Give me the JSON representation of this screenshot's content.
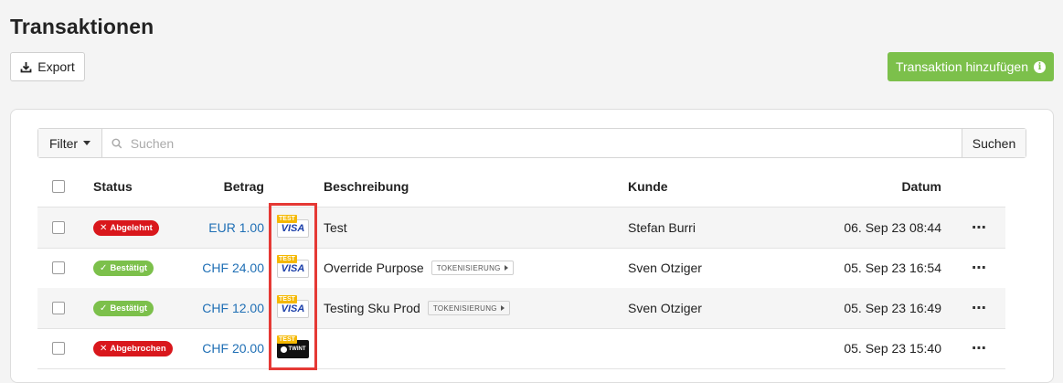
{
  "page": {
    "title": "Transaktionen"
  },
  "toolbar": {
    "export_label": "Export",
    "add_label": "Transaktion hinzufügen"
  },
  "search": {
    "filter_label": "Filter",
    "placeholder": "Suchen",
    "button_label": "Suchen"
  },
  "table": {
    "headers": {
      "status": "Status",
      "amount": "Betrag",
      "description": "Beschreibung",
      "customer": "Kunde",
      "date": "Datum"
    },
    "rows": [
      {
        "status": "Abgelehnt",
        "status_type": "declined",
        "amount": "EUR 1.00",
        "payment_method": "visa-test",
        "description": "Test",
        "tag": "",
        "customer": "Stefan Burri",
        "date": "06. Sep 23 08:44"
      },
      {
        "status": "Bestätigt",
        "status_type": "confirmed",
        "amount": "CHF 24.00",
        "payment_method": "visa-test",
        "description": "Override Purpose",
        "tag": "TOKENISIERUNG",
        "customer": "Sven Otziger",
        "date": "05. Sep 23 16:54"
      },
      {
        "status": "Bestätigt",
        "status_type": "confirmed",
        "amount": "CHF 12.00",
        "payment_method": "visa-test",
        "description": "Testing Sku Prod",
        "tag": "TOKENISIERUNG",
        "customer": "Sven Otziger",
        "date": "05. Sep 23 16:49"
      },
      {
        "status": "Abgebrochen",
        "status_type": "cancelled",
        "amount": "CHF 20.00",
        "payment_method": "twint-test",
        "description": "",
        "tag": "",
        "customer": "",
        "date": "05. Sep 23 15:40"
      }
    ]
  },
  "payment_labels": {
    "visa": "VISA",
    "twint": "TWINT",
    "test": "TEST"
  },
  "colors": {
    "primary_green": "#7cc04b",
    "danger_red": "#d9171c",
    "link_blue": "#1f6fb5",
    "highlight": "#e53935"
  },
  "icons": {
    "more": "⋯",
    "declined": "✕",
    "confirmed": "✓"
  }
}
